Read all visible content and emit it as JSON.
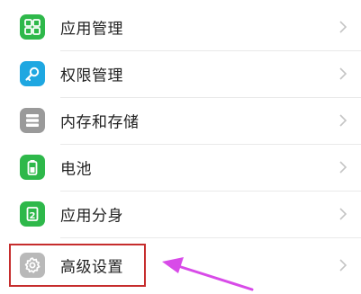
{
  "settings": {
    "items": [
      {
        "label": "应用管理",
        "icon": "app-management-icon",
        "color": "#2eb84a"
      },
      {
        "label": "权限管理",
        "icon": "key-icon",
        "color": "#1ea7e1"
      },
      {
        "label": "内存和存储",
        "icon": "storage-icon",
        "color": "#9a9a9a"
      },
      {
        "label": "电池",
        "icon": "battery-icon",
        "color": "#2eb84a"
      },
      {
        "label": "应用分身",
        "icon": "app-clone-icon",
        "color": "#2eb84a"
      },
      {
        "label": "高级设置",
        "icon": "gear-icon",
        "color": "#b9b9b9"
      }
    ]
  },
  "annotation": {
    "highlight_color": "#c62d2d",
    "arrow_color": "#d84be8"
  }
}
